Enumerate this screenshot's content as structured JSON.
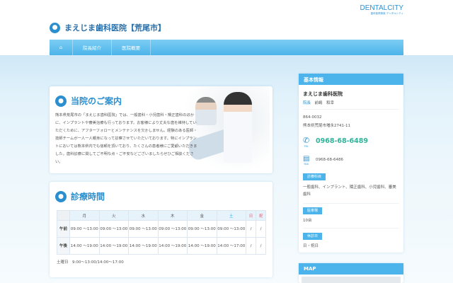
{
  "brand": {
    "name": "DENTALCITY",
    "sub": "歯科医院検索 デンタルシティ"
  },
  "site": {
    "title": "まえじま歯科医院【荒尾市】"
  },
  "nav": {
    "items": [
      {
        "label": "院長紹介"
      },
      {
        "label": "医院概要"
      }
    ]
  },
  "intro": {
    "heading": "当院のご案内",
    "text": "熊本県荒尾市の「まえじま歯科医院」では、一般歯科・小児歯科・矯正歯科のほかに、インプラントや審美治療も行っております。お客様により丈夫な歯を維持していただくために、アフターフォローとメンテナンスを欠かしません。経験のある医師・技師チームが一人一人親身になって診察させていただいております。特にインプラントにおいては熊本県内でも信頼を頂いており、たくさんの患者様にご愛顧いただきました。歯科診療に関してご不明な点・ご不安などございましたらぜひご相談ください。"
  },
  "hours": {
    "heading": "診療時間",
    "days": [
      "月",
      "火",
      "水",
      "木",
      "金",
      "土",
      "日",
      "祝"
    ],
    "rows": [
      {
        "label": "午前",
        "cells": [
          "09:00 ～13:00",
          "09:00 ～13:00",
          "09:00 ～13:00",
          "09:00 ～13:00",
          "09:00 ～13:00",
          "09:00 ～13:00",
          "/",
          "/"
        ]
      },
      {
        "label": "午後",
        "cells": [
          "14:00 ～19:00",
          "14:00 ～19:00",
          "14:00 ～19:00",
          "14:00 ～19:00",
          "14:00 ～19:00",
          "14:00 ～17:00",
          "/",
          "/"
        ]
      }
    ],
    "note": "土曜日　9:00～13:00/14:00～17:00"
  },
  "info": {
    "heading": "基本情報",
    "clinic": "まえじま歯科医院",
    "director_label": "院長",
    "director": "前嶋　和幸",
    "zip": "864-0032",
    "address": "熊本県荒尾市増永2741-11",
    "tel_label": "TEL",
    "tel": "0968-68-6489",
    "fax_label": "FAX",
    "fax": "0968-68-6486",
    "subjects_label": "診療科目",
    "subjects": "一般歯科、インプラント、矯正歯科、小児歯科、審美歯科",
    "parking_label": "駐車場",
    "parking": "10台",
    "closed_label": "休診日",
    "closed": "日・祝日"
  },
  "map": {
    "heading": "MAP"
  }
}
